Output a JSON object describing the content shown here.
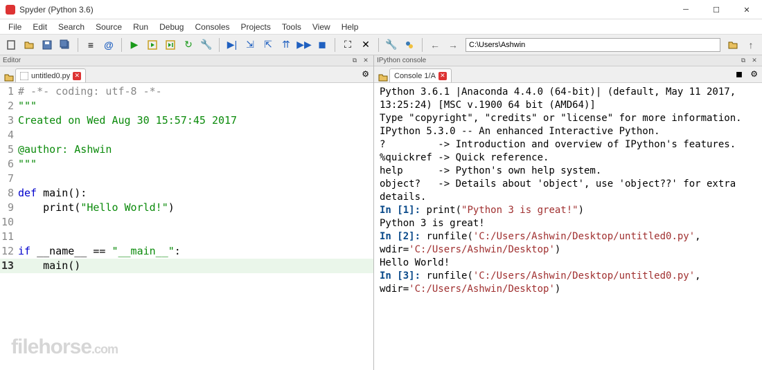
{
  "window": {
    "title": "Spyder (Python 3.6)"
  },
  "menu": [
    "File",
    "Edit",
    "Search",
    "Source",
    "Run",
    "Debug",
    "Consoles",
    "Projects",
    "Tools",
    "View",
    "Help"
  ],
  "nav": {
    "path": "C:\\Users\\Ashwin"
  },
  "editor_pane_label": "Editor",
  "console_pane_label": "IPython console",
  "editor_tab": {
    "label": "untitled0.py"
  },
  "console_tab": {
    "label": "Console 1/A"
  },
  "code": {
    "l1": "# -*- coding: utf-8 -*-",
    "l2": "\"\"\"",
    "l3": "Created on Wed Aug 30 15:57:45 2017",
    "l4": "",
    "l5": "@author: Ashwin",
    "l6": "\"\"\"",
    "l7": "",
    "l8_def": "def ",
    "l8_name": "main",
    "l8_paren": "():",
    "l9_indent": "    ",
    "l9_print": "print",
    "l9_open": "(",
    "l9_str": "\"Hello World!\"",
    "l9_close": ")",
    "l10": "",
    "l11": "",
    "l12_if": "if ",
    "l12_name": "__name__",
    "l12_eq": " == ",
    "l12_str": "\"__main__\"",
    "l12_colon": ":",
    "l13_indent": "    ",
    "l13_call": "main",
    "l13_paren": "()"
  },
  "console": {
    "banner1": "Python 3.6.1 |Anaconda 4.4.0 (64-bit)| (default, May 11 2017, 13:25:24) [MSC v.1900 64 bit (AMD64)]",
    "banner2": "Type \"copyright\", \"credits\" or \"license\" for more information.",
    "blank": "",
    "ipy1": "IPython 5.3.0 -- An enhanced Interactive Python.",
    "ipy2": "?         -> Introduction and overview of IPython's features.",
    "ipy3": "%quickref -> Quick reference.",
    "ipy4": "help      -> Python's own help system.",
    "ipy5": "object?   -> Details about 'object', use 'object??' for extra details.",
    "in1_p": "In [1]: ",
    "in1_a": "print(",
    "in1_s": "\"Python 3 is great!\"",
    "in1_b": ")",
    "out1": "Python 3 is great!",
    "in2_p": "In [2]: ",
    "in2_a": "runfile(",
    "in2_s1": "'C:/Users/Ashwin/Desktop/untitled0.py'",
    "in2_b": ", wdir=",
    "in2_s2": "'C:/Users/Ashwin/Desktop'",
    "in2_c": ")",
    "out2": "Hello World!",
    "in3_p": "In [3]: ",
    "in3_a": "runfile(",
    "in3_s1": "'C:/Users/Ashwin/Desktop/untitled0.py'",
    "in3_b": ", wdir=",
    "in3_s2": "'C:/Users/Ashwin/Desktop'",
    "in3_c": ")"
  },
  "watermark": {
    "main": "filehorse",
    "ext": ".com"
  }
}
